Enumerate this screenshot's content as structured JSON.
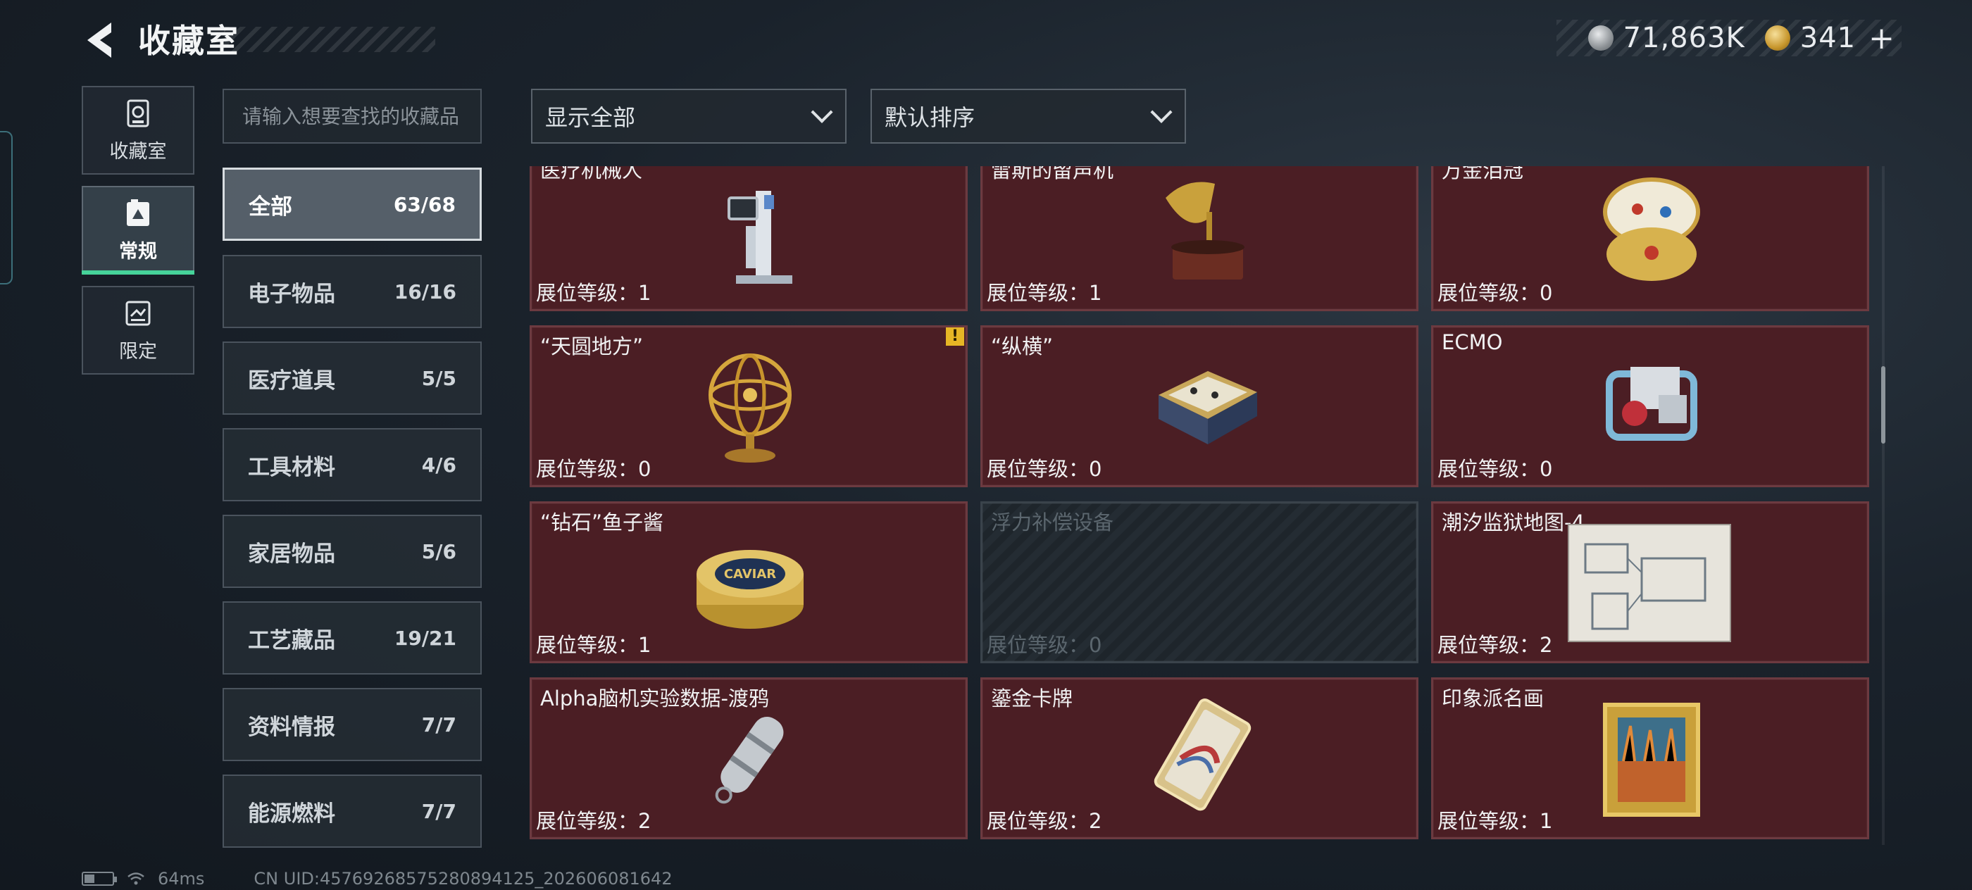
{
  "header": {
    "title": "收藏室",
    "currency": [
      {
        "icon": "silver-coin-icon",
        "value": "71,863K"
      },
      {
        "icon": "gold-coin-icon",
        "value": "341"
      }
    ],
    "plus": "+"
  },
  "nav": [
    {
      "label": "收藏室",
      "icon": "collection-icon"
    },
    {
      "label": "常规",
      "icon": "album-icon",
      "active": true
    },
    {
      "label": "限定",
      "icon": "limited-icon"
    }
  ],
  "search": {
    "placeholder": "请输入想要查找的收藏品"
  },
  "categories": [
    {
      "label": "全部",
      "count": "63/68",
      "active": true
    },
    {
      "label": "电子物品",
      "count": "16/16"
    },
    {
      "label": "医疗道具",
      "count": "5/5"
    },
    {
      "label": "工具材料",
      "count": "4/6"
    },
    {
      "label": "家居物品",
      "count": "5/6"
    },
    {
      "label": "工艺藏品",
      "count": "19/21"
    },
    {
      "label": "资料情报",
      "count": "7/7"
    },
    {
      "label": "能源燃料",
      "count": "7/7"
    }
  ],
  "filters": {
    "filter": "显示全部",
    "sort": "默认排序"
  },
  "items": [
    {
      "name": "医疗机械人",
      "level": "展位等级：1",
      "icon": "medical-robot-icon"
    },
    {
      "name": "雷斯的留声机",
      "level": "展位等级：1",
      "icon": "gramophone-icon"
    },
    {
      "name": "万金泪冠",
      "level": "展位等级：0",
      "icon": "jeweled-egg-icon"
    },
    {
      "name": "“天圆地方”",
      "level": "展位等级：0",
      "icon": "armillary-sphere-icon",
      "badge": "!"
    },
    {
      "name": "“纵横”",
      "level": "展位等级：0",
      "icon": "chessboard-icon"
    },
    {
      "name": "ECMO",
      "level": "展位等级：0",
      "icon": "ecmo-machine-icon"
    },
    {
      "name": "“钻石”鱼子酱",
      "level": "展位等级：1",
      "icon": "caviar-tin-icon",
      "label_on_tin": "CAVIAR"
    },
    {
      "name": "浮力补偿设备",
      "level": "展位等级：0",
      "icon": "empty-slot-icon",
      "empty": true
    },
    {
      "name": "潮汐监狱地图-4",
      "level": "展位等级：2",
      "icon": "prison-map-icon"
    },
    {
      "name": "Alpha脑机实验数据-渡鸦",
      "level": "展位等级：2",
      "icon": "data-capsule-icon"
    },
    {
      "name": "鎏金卡牌",
      "level": "展位等级：2",
      "icon": "gilded-card-icon"
    },
    {
      "name": "印象派名画",
      "level": "展位等级：1",
      "icon": "framed-painting-icon"
    }
  ],
  "status": {
    "ping": "64ms",
    "uid": "CN UID:45769268575280894125_202606081642"
  },
  "colors": {
    "card_bg": "#4b1e24",
    "accent_green": "#46d39a",
    "warn": "#e6b625"
  }
}
